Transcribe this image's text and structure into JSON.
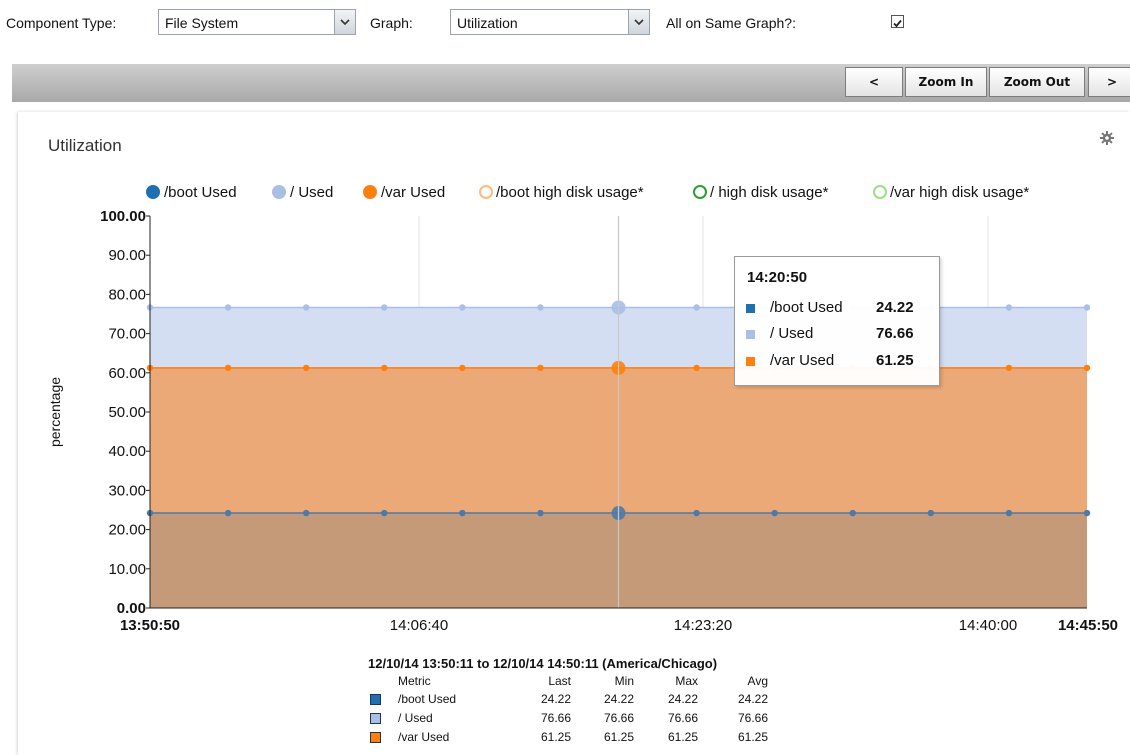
{
  "controls": {
    "component_type_label": "Component Type:",
    "component_type_value": "File System",
    "graph_label": "Graph:",
    "graph_value": "Utilization",
    "same_graph_label": "All on Same Graph?:",
    "same_graph_checked": true
  },
  "toolbar": {
    "prev_label": "<",
    "zoom_in_label": "Zoom In",
    "zoom_out_label": "Zoom Out",
    "next_label": ">"
  },
  "panel": {
    "title": "Utilization"
  },
  "chart_data": {
    "type": "area",
    "ylabel": "percentage",
    "ylim": [
      0,
      100
    ],
    "y_ticks": [
      "0.00",
      "10.00",
      "20.00",
      "30.00",
      "40.00",
      "50.00",
      "60.00",
      "70.00",
      "80.00",
      "90.00",
      "100.00"
    ],
    "x_ticks": [
      "13:50:50",
      "14:06:40",
      "14:23:20",
      "14:40:00",
      "14:45:50"
    ],
    "legend_position": "top",
    "legend": [
      {
        "name": "/boot Used",
        "style": "filled",
        "color": "#1f6fb2"
      },
      {
        "name": "/ Used",
        "style": "filled",
        "color": "#a9bfe6"
      },
      {
        "name": "/var Used",
        "style": "filled",
        "color": "#ff7f0e"
      },
      {
        "name": "/boot high disk usage*",
        "style": "hollow",
        "color": "#ffbb78"
      },
      {
        "name": "/ high disk usage*",
        "style": "hollow",
        "color": "#2ca02c"
      },
      {
        "name": "/var high disk usage*",
        "style": "hollow",
        "color": "#98df8a"
      }
    ],
    "series": [
      {
        "name": "/ Used",
        "color": "#a9bfe6",
        "fill": "#d3def2",
        "values": [
          76.66,
          76.66,
          76.66,
          76.66,
          76.66,
          76.66,
          76.66,
          76.66,
          76.66,
          76.66,
          76.66,
          76.66,
          76.66
        ]
      },
      {
        "name": "/var Used",
        "color": "#ff7f0e",
        "fill": "#eba978",
        "values": [
          61.25,
          61.25,
          61.25,
          61.25,
          61.25,
          61.25,
          61.25,
          61.25,
          61.25,
          61.25,
          61.25,
          61.25,
          61.25
        ]
      },
      {
        "name": "/boot Used",
        "color": "#4e79a7",
        "fill": "#c49a78",
        "values": [
          24.22,
          24.22,
          24.22,
          24.22,
          24.22,
          24.22,
          24.22,
          24.22,
          24.22,
          24.22,
          24.22,
          24.22,
          24.22
        ]
      }
    ],
    "hover_index": 6,
    "tooltip": {
      "time": "14:20:50",
      "rows": [
        {
          "name": "/boot Used",
          "value": "24.22",
          "color": "#1f6fb2"
        },
        {
          "name": "/ Used",
          "value": "76.66",
          "color": "#a9bfe6"
        },
        {
          "name": "/var Used",
          "value": "61.25",
          "color": "#ff7f0e"
        }
      ]
    },
    "summary": {
      "range": "12/10/14 13:50:11 to 12/10/14 14:50:11 (America/Chicago)",
      "headers": [
        "Metric",
        "Last",
        "Min",
        "Max",
        "Avg"
      ],
      "rows": [
        {
          "metric": "/boot Used",
          "color": "#1f6fb2",
          "last": "24.22",
          "min": "24.22",
          "max": "24.22",
          "avg": "24.22"
        },
        {
          "metric": "/ Used",
          "color": "#a9bfe6",
          "last": "76.66",
          "min": "76.66",
          "max": "76.66",
          "avg": "76.66"
        },
        {
          "metric": "/var Used",
          "color": "#ff7f0e",
          "last": "61.25",
          "min": "61.25",
          "max": "61.25",
          "avg": "61.25"
        }
      ]
    }
  }
}
